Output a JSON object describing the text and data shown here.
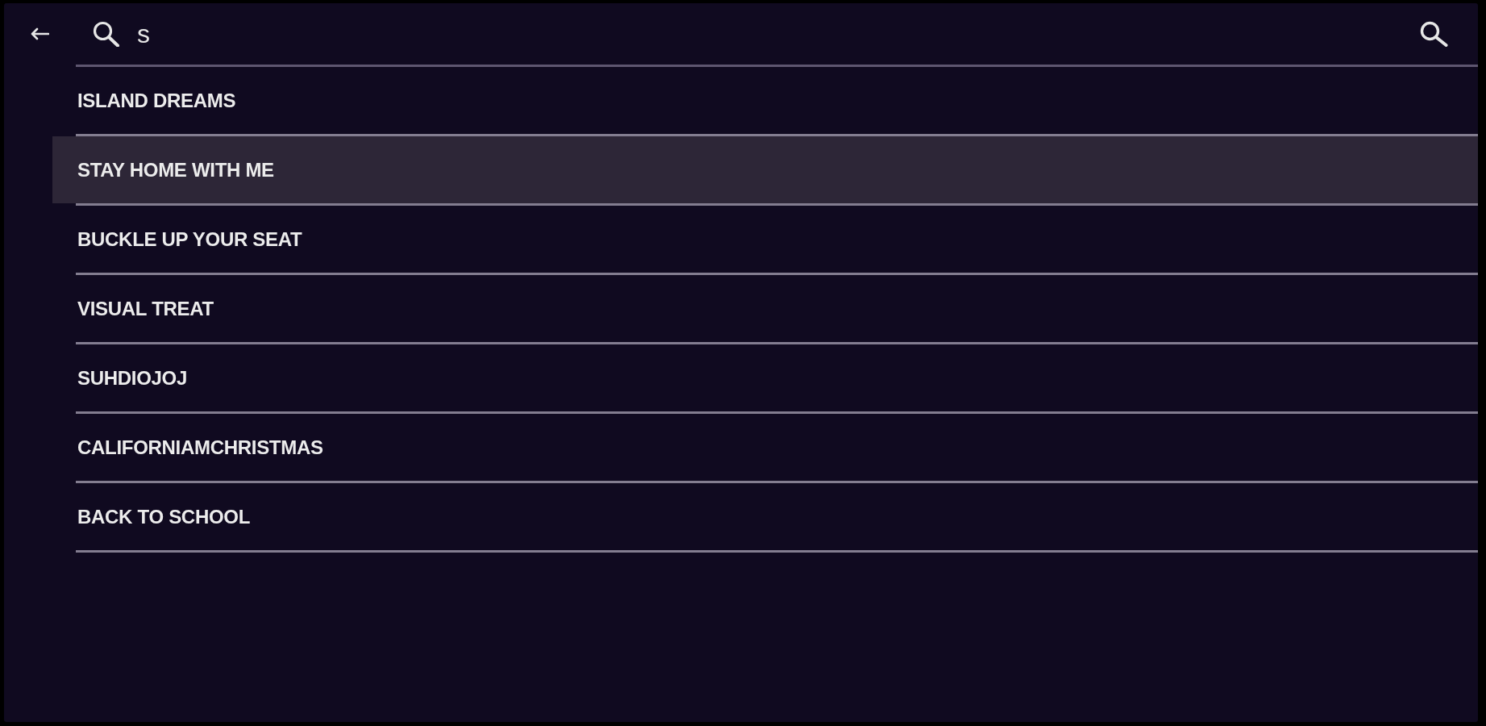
{
  "header": {
    "search_query": "s"
  },
  "results": [
    {
      "title": "ISLAND DREAMS",
      "selected": false
    },
    {
      "title": "STAY HOME WITH ME",
      "selected": true
    },
    {
      "title": "BUCKLE UP YOUR SEAT",
      "selected": false
    },
    {
      "title": "VISUAL TREAT",
      "selected": false
    },
    {
      "title": "SUHDIOJOJ",
      "selected": false
    },
    {
      "title": "CALIFORNIAMCHRISTMAS",
      "selected": false
    },
    {
      "title": "BACK TO SCHOOL",
      "selected": false
    }
  ]
}
